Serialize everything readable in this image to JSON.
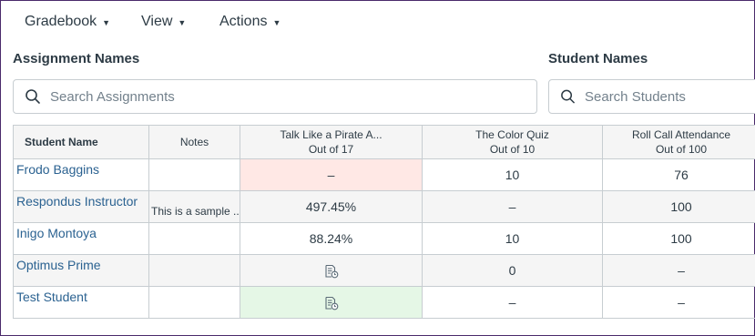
{
  "menu": {
    "gradebook": "Gradebook",
    "view": "View",
    "actions": "Actions",
    "caret": "▼"
  },
  "assignment_search": {
    "label": "Assignment Names",
    "placeholder": "Search Assignments"
  },
  "student_search": {
    "label": "Student Names",
    "placeholder": "Search Students"
  },
  "columns": {
    "student_name": "Student Name",
    "notes": "Notes",
    "a1_title": "Talk Like a Pirate A...",
    "a1_points": "Out of 17",
    "a2_title": "The Color Quiz",
    "a2_points": "Out of 10",
    "a3_title": "Roll Call Attendance",
    "a3_points": "Out of 100"
  },
  "rows": [
    {
      "name": "Frodo Baggins",
      "notes": "",
      "a1": "–",
      "a2": "10",
      "a3": "76"
    },
    {
      "name": "Respondus Instructor",
      "notes": "This is a sample ...",
      "a1": "497.45%",
      "a2": "–",
      "a3": "100"
    },
    {
      "name": "Inigo Montoya",
      "notes": "",
      "a1": "88.24%",
      "a2": "10",
      "a3": "100"
    },
    {
      "name": "Optimus Prime",
      "notes": "",
      "a1": "",
      "a2": "0",
      "a3": "–"
    },
    {
      "name": "Test Student",
      "notes": "",
      "a1": "",
      "a2": "–",
      "a3": "–"
    }
  ],
  "icons": {
    "search": "search-icon",
    "submitted": "document-clock-icon"
  },
  "colors": {
    "missing_cell": "#ffe8e5",
    "excused_cell": "#e5f7e6",
    "link": "#2b6291",
    "window_border": "#4b2a6b"
  }
}
